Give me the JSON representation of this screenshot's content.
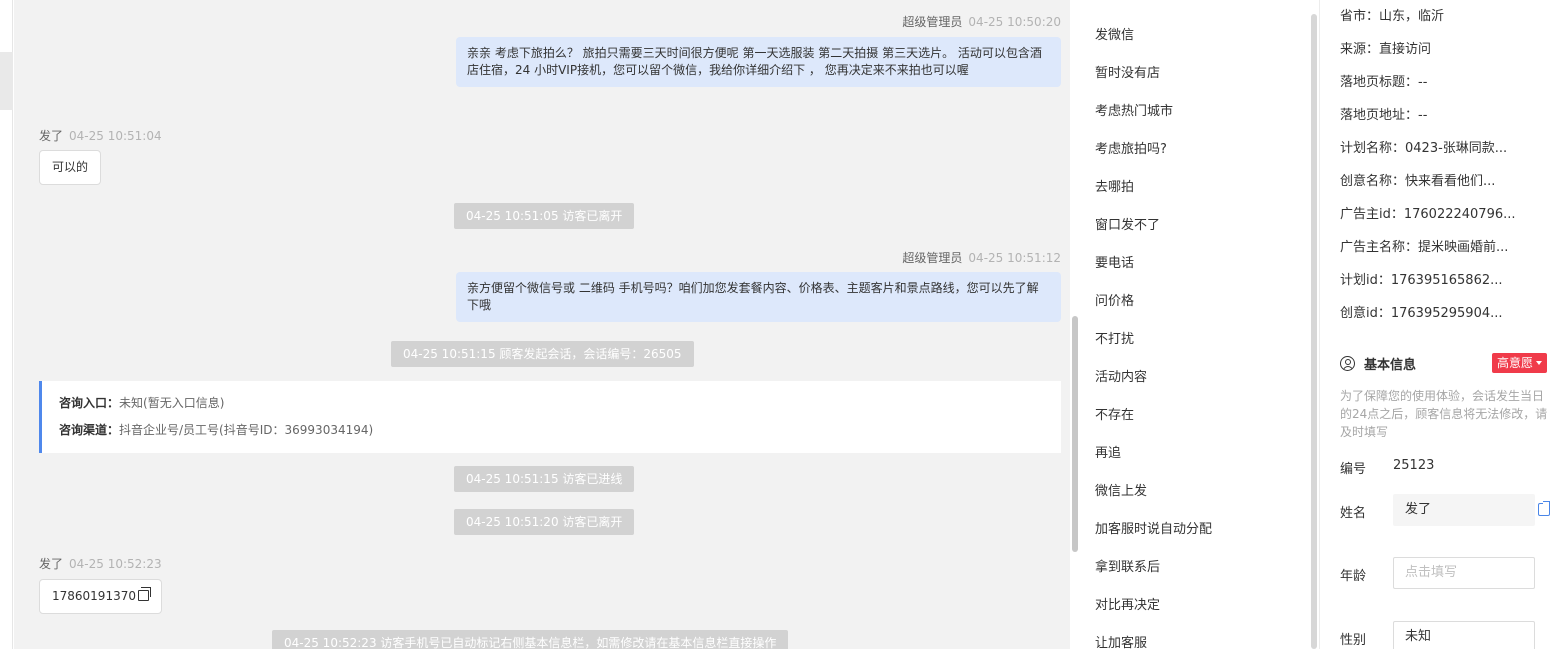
{
  "chat": {
    "messages": [
      {
        "who": "超级管理员",
        "time": "04-25 10:50:20",
        "text": "亲亲 考虑下旅拍么？ 旅拍只需要三天时间很方便呢 第一天选服装 第二天拍摄 第三天选片。 活动可以包含酒店住宿，24 小时VIP接机，您可以留个微信，我给你详细介绍下 ， 您再决定来不来拍也可以喔"
      },
      {
        "who": "发了",
        "time": "04-25 10:51:04",
        "text": "可以的"
      },
      {
        "system": "04-25 10:51:05 访客已离开"
      },
      {
        "who": "超级管理员",
        "time": "04-25 10:51:12",
        "text": "亲方便留个微信号或 二维码 手机号吗？咱们加您发套餐内容、价格表、主题客片和景点路线，您可以先了解下哦"
      },
      {
        "system": "04-25 10:51:15 顾客发起会话，会话编号：26505"
      },
      {
        "system": "04-25 10:51:15 访客已进线"
      },
      {
        "system": "04-25 10:51:20 访客已离开"
      },
      {
        "who": "发了",
        "time": "04-25 10:52:23",
        "text": "17860191370"
      },
      {
        "system": "04-25 10:52:23 访客手机号已自动标记右侧基本信息栏，如需修改请在基本信息栏直接操作"
      }
    ],
    "info_card": {
      "entry_label": "咨询入口：",
      "entry_value": "未知(暂无入口信息)",
      "channel_label": "咨询渠道：",
      "channel_value": "抖音企业号/员工号(抖音号ID：36993034194)"
    }
  },
  "quick_replies": [
    "发微信",
    "暂时没有店",
    "考虑热门城市",
    "考虑旅拍吗?",
    "去哪拍",
    "窗口发不了",
    "要电话",
    "问价格",
    "不打扰",
    "活动内容",
    "不存在",
    "再追",
    "微信上发",
    "加客服时说自动分配",
    "拿到联系后",
    "对比再决定",
    "让加客服"
  ],
  "visitor_info": {
    "rows": [
      "省市：山东，临沂",
      "来源：直接访问",
      "落地页标题：--",
      "落地页地址：--",
      "计划名称：0423-张琳同款...",
      "创意名称：快来看看他们...",
      "广告主id：176022240796...",
      "广告主名称：提米映画婚前...",
      "计划id：176395165862...",
      "创意id：176395295904..."
    ],
    "section_title": "基本信息",
    "intent_badge": "高意愿",
    "hint": "为了保障您的使用体验，会话发生当日的24点之后，顾客信息将无法修改，请及时填写",
    "fields": {
      "id_label": "编号",
      "id_value": "25123",
      "name_label": "姓名",
      "name_value": "发了",
      "age_label": "年龄",
      "age_placeholder": "点击填写",
      "gender_label": "性别",
      "gender_value": "未知"
    }
  },
  "colors": {
    "agent_bubble": "#dde8fb",
    "chat_bg": "#f2f2f2",
    "accent_blue": "#4f88ec",
    "badge_red": "#f03b4a",
    "system_notice": "#d2d2d2"
  }
}
